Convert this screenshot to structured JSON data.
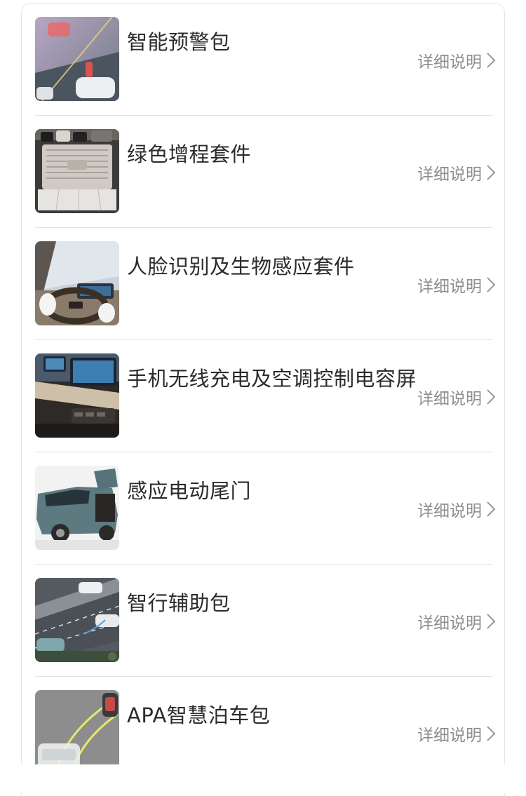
{
  "products": [
    {
      "title": "智能预警包",
      "detail": "详细说明",
      "image": "warning-pack-photo"
    },
    {
      "title": "绿色增程套件",
      "detail": "详细说明",
      "image": "range-extender-photo"
    },
    {
      "title": "人脸识别及生物感应套件",
      "detail": "详细说明",
      "image": "face-recognition-photo"
    },
    {
      "title": "手机无线充电及空调控制电容屏",
      "detail": "详细说明",
      "image": "wireless-charging-photo"
    },
    {
      "title": "感应电动尾门",
      "detail": "详细说明",
      "image": "power-tailgate-photo"
    },
    {
      "title": "智行辅助包",
      "detail": "详细说明",
      "image": "driving-assist-photo"
    },
    {
      "title": "APA智慧泊车包",
      "detail": "详细说明",
      "image": "apa-parking-photo"
    }
  ],
  "icons": {
    "detail_arrow": "chevron-right-icon"
  },
  "colors": {
    "title": "#2b2b2b",
    "detail": "#8e8e8e",
    "divider": "#e2e2e2"
  }
}
